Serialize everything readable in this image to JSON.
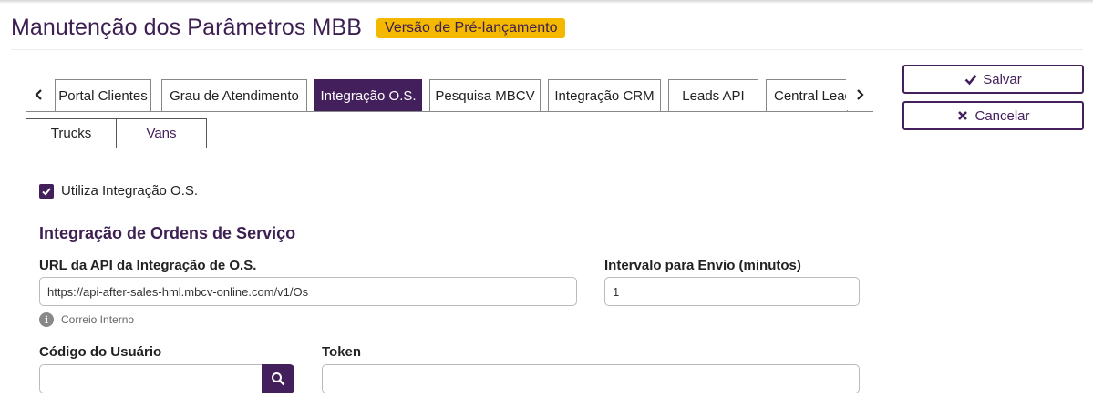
{
  "header": {
    "title": "Manutenção dos Parâmetros MBB",
    "badge": "Versão de Pré-lançamento"
  },
  "tabs": [
    {
      "label": "Portal Clientes",
      "active": false
    },
    {
      "label": "Grau de Atendimento",
      "active": false
    },
    {
      "label": "Integração O.S.",
      "active": true
    },
    {
      "label": "Pesquisa MBCV",
      "active": false
    },
    {
      "label": "Integração CRM",
      "active": false
    },
    {
      "label": "Leads API",
      "active": false
    },
    {
      "label": "Central Leads",
      "active": false
    }
  ],
  "subtabs": [
    {
      "label": "Trucks",
      "active": false
    },
    {
      "label": "Vans",
      "active": true
    }
  ],
  "actions": {
    "save_label": "Salvar",
    "cancel_label": "Cancelar"
  },
  "form": {
    "use_integration_label": "Utiliza Integração O.S.",
    "use_integration_checked": true,
    "section_title": "Integração de Ordens de Serviço",
    "api_url_label": "URL da API da Integração de O.S.",
    "api_url_value": "https://api-after-sales-hml.mbcv-online.com/v1/Os",
    "interval_label": "Intervalo para Envio (minutos)",
    "interval_value": "1",
    "hint_text": "Correio Interno",
    "user_code_label": "Código do Usuário",
    "user_code_value": "",
    "token_label": "Token",
    "token_value": ""
  },
  "colors": {
    "brand": "#43205c",
    "badge": "#f5b800"
  }
}
